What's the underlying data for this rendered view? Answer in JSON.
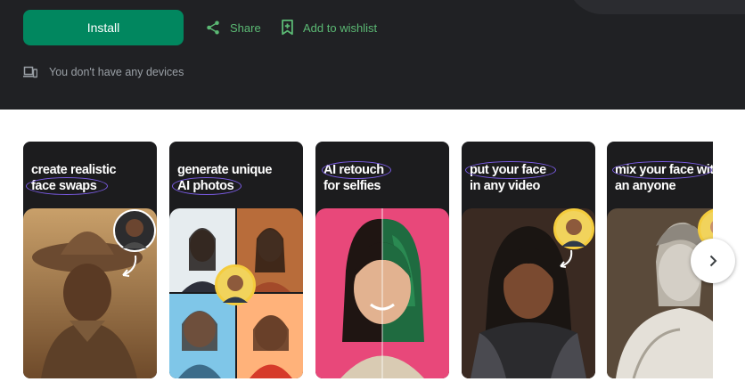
{
  "actions": {
    "install_label": "Install",
    "share_label": "Share",
    "wishlist_label": "Add to wishlist"
  },
  "devices_text": "You don't have any devices",
  "screenshots": [
    {
      "caption": "create realistic\nface swaps"
    },
    {
      "caption": "generate unique\nAI photos"
    },
    {
      "caption": "AI retouch\nfor selfies"
    },
    {
      "caption": "put your face\nin any video"
    },
    {
      "caption": "mix your face with\nan anyone"
    }
  ],
  "icons": {
    "share": "share-icon",
    "wishlist": "bookmark-add-icon",
    "devices": "devices-icon",
    "next": "chevron-right-icon"
  },
  "colors": {
    "header_bg": "#202124",
    "install_bg": "#01875f",
    "accent": "#5bb974",
    "caption_ring": "#7b5ce6"
  }
}
